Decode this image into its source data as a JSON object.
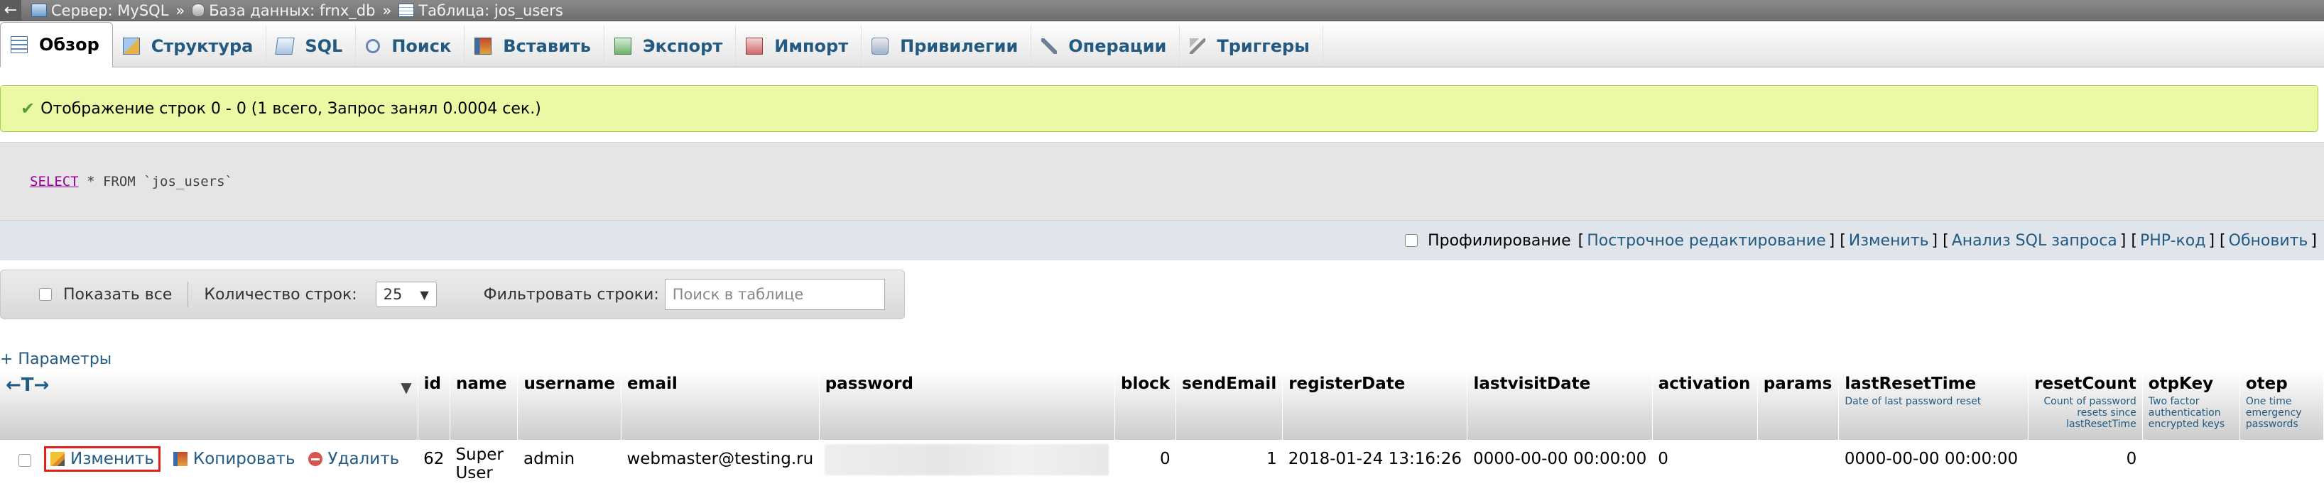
{
  "breadcrumb": {
    "back": "←",
    "server": "Сервер: MySQL",
    "database": "База данных: frnx_db",
    "table": "Таблица: jos_users",
    "separator": "»"
  },
  "tabs": [
    {
      "label": "Обзор",
      "icon": "browse-icon",
      "active": true
    },
    {
      "label": "Структура",
      "icon": "structure-icon"
    },
    {
      "label": "SQL",
      "icon": "sql-icon"
    },
    {
      "label": "Поиск",
      "icon": "search-icon"
    },
    {
      "label": "Вставить",
      "icon": "insert-icon"
    },
    {
      "label": "Экспорт",
      "icon": "export-icon"
    },
    {
      "label": "Импорт",
      "icon": "import-icon"
    },
    {
      "label": "Привилегии",
      "icon": "privileges-icon"
    },
    {
      "label": "Операции",
      "icon": "operations-icon"
    },
    {
      "label": "Триггеры",
      "icon": "triggers-icon"
    }
  ],
  "message": {
    "text": "Отображение строк 0 - 0 (1 всего, Запрос занял 0.0004 сек.)"
  },
  "sql": {
    "select": "SELECT",
    "rest": " * FROM `jos_users`"
  },
  "profiling": {
    "label": "Профилирование",
    "links": [
      "Построчное редактирование",
      "Изменить",
      "Анализ SQL запроса",
      "PHP-код",
      "Обновить"
    ]
  },
  "nav": {
    "show_all": "Показать все",
    "row_count_label": "Количество строк:",
    "row_count_value": "25",
    "filter_label": "Фильтровать строки:",
    "filter_placeholder": "Поиск в таблице"
  },
  "options_link": "+ Параметры",
  "table": {
    "arrows": "←T→",
    "columns": [
      {
        "name": "id"
      },
      {
        "name": "name"
      },
      {
        "name": "username"
      },
      {
        "name": "email"
      },
      {
        "name": "password"
      },
      {
        "name": "block"
      },
      {
        "name": "sendEmail"
      },
      {
        "name": "registerDate"
      },
      {
        "name": "lastvisitDate"
      },
      {
        "name": "activation"
      },
      {
        "name": "params"
      },
      {
        "name": "lastResetTime",
        "comment": "Date of last password reset"
      },
      {
        "name": "resetCount",
        "comment": "Count of password resets since lastResetTime"
      },
      {
        "name": "otpKey",
        "comment": "Two factor authentication encrypted keys"
      },
      {
        "name": "otep",
        "comment": "One time emergency passwords"
      }
    ],
    "actions": {
      "edit": "Изменить",
      "copy": "Копировать",
      "delete": "Удалить"
    },
    "rows": [
      {
        "id": "62",
        "name": "Super User",
        "username": "admin",
        "email": "webmaster@testing.ru",
        "block": "0",
        "sendEmail": "1",
        "registerDate": "2018-01-24 13:16:26",
        "lastvisitDate": "0000-00-00 00:00:00",
        "activation": "0",
        "params": "",
        "lastResetTime": "0000-00-00 00:00:00",
        "resetCount": "0",
        "otpKey": "",
        "otep": ""
      }
    ]
  }
}
